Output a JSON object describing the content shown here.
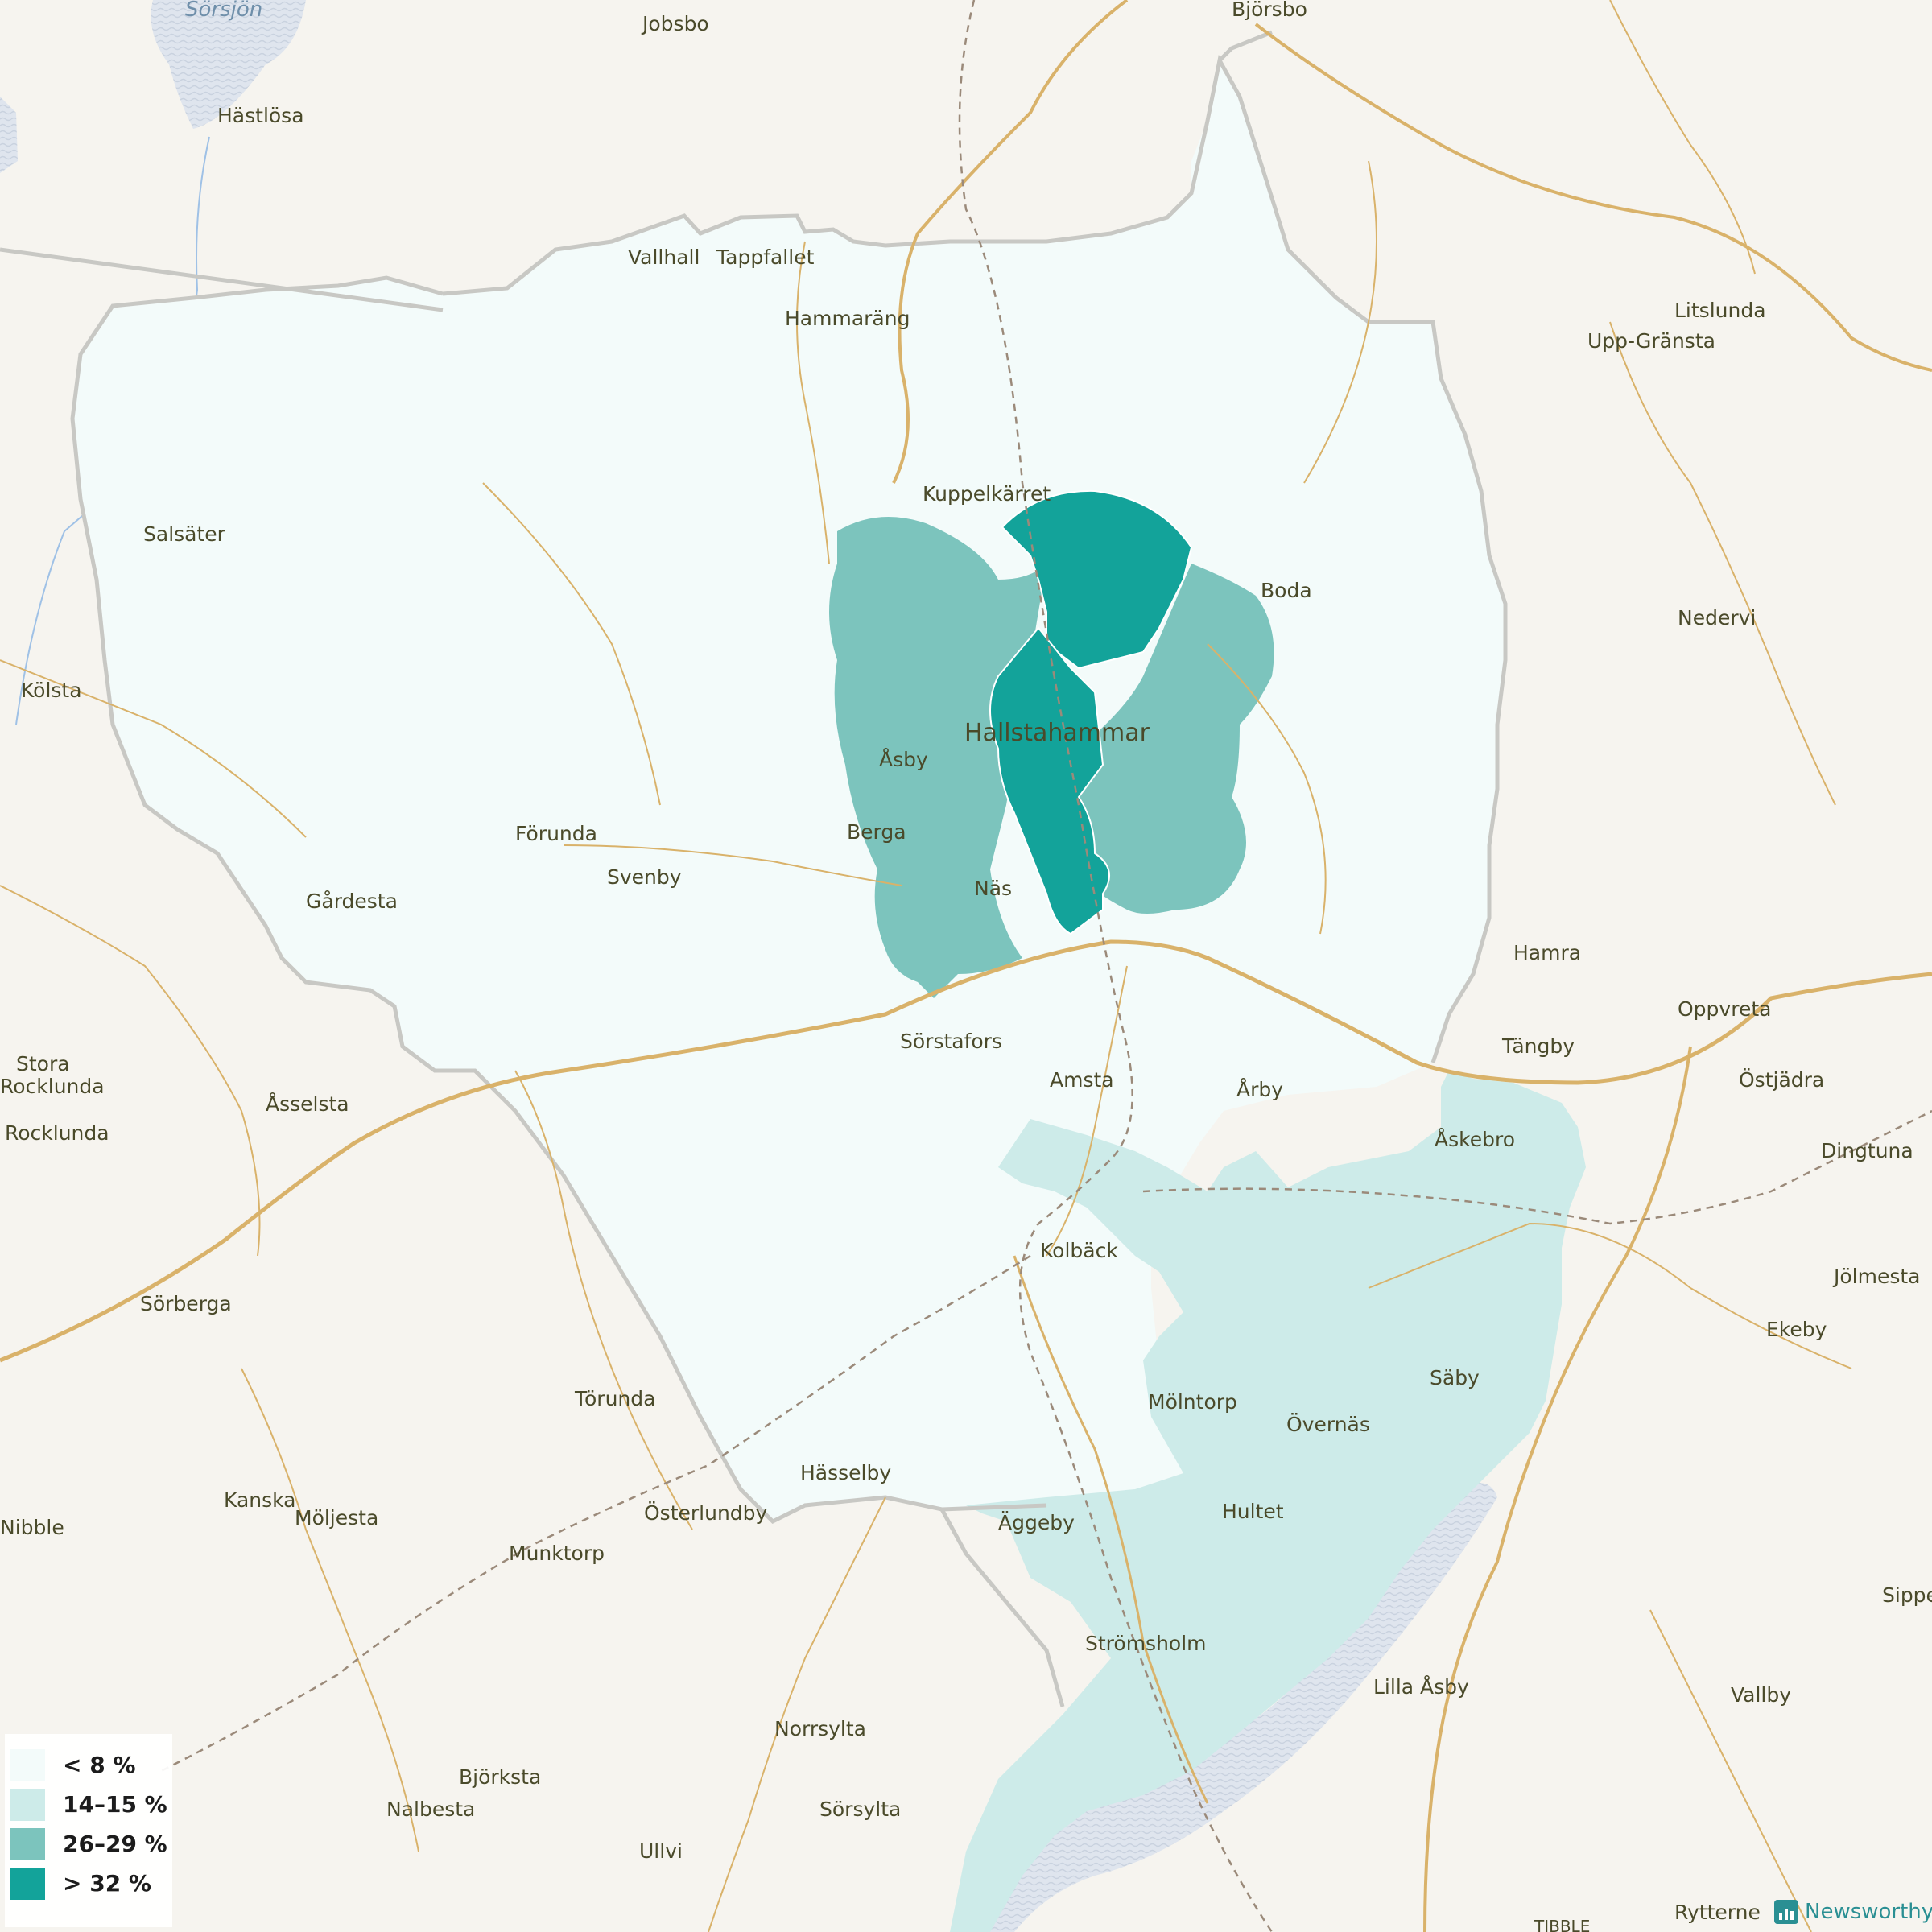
{
  "legend": {
    "items": [
      {
        "label": "< 8 %",
        "color": "#f3fbfa"
      },
      {
        "label": "14–15 %",
        "color": "#cdebe9"
      },
      {
        "label": "26–29 %",
        "color": "#7cc4bd"
      },
      {
        "label": "> 32 %",
        "color": "#13a39a"
      }
    ]
  },
  "brand": {
    "name": "Newsworthy",
    "icon": "bar-chart-icon"
  },
  "colors": {
    "background": "#f6f4ef",
    "road": "#d9b26a",
    "boundary": "#c8c8c4",
    "water": "#a9bfd4"
  },
  "places": {
    "sorsjon": "Sörsjön",
    "jobsbo": "Jobsbo",
    "bjorsbo": "Björsbo",
    "hastlosa": "Hästlösa",
    "vallhall": "Vallhall",
    "tappfallet": "Tappfallet",
    "hammarang": "Hammaräng",
    "litslunda": "Litslunda",
    "upp_gransta": "Upp-Gränsta",
    "salsater": "Salsäter",
    "kuppelkarret": "Kuppelkärret",
    "boda": "Boda",
    "nedervi": "Nedervi",
    "kolsta": "Kölsta",
    "hallstahammar": "Hallstahammar",
    "asby": "Åsby",
    "forunda": "Förunda",
    "berga": "Berga",
    "gardesta": "Gårdesta",
    "svenby": "Svenby",
    "nas": "Näs",
    "hamra": "Hamra",
    "oppvreta": "Oppvreta",
    "sorstafors": "Sörstafors",
    "tangby": "Tängby",
    "stora": "Stora",
    "rocklunda": "Rocklunda",
    "amsta": "Amsta",
    "arby": "Årby",
    "ostjadra": "Östjädra",
    "asselsta": "Åsselsta",
    "rocklunda2": "Rocklunda",
    "askebro": "Åskebro",
    "dingtuna": "Dingtuna",
    "kolback": "Kolbäck",
    "sorberga": "Sörberga",
    "jolmesta": "Jölmesta",
    "ekeby": "Ekeby",
    "saby": "Säby",
    "torunda": "Törunda",
    "molntorp": "Mölntorp",
    "overnas": "Övernäs",
    "hasselby": "Hässelby",
    "kanska": "Kanska",
    "hultet": "Hultet",
    "nibble": "Nibble",
    "moljesta": "Möljesta",
    "osterlundby": "Österlundby",
    "aggeby": "Äggeby",
    "munktorp": "Munktorp",
    "sippe": "Sippe",
    "stromsholm": "Strömsholm",
    "lilla_asby": "Lilla Åsby",
    "vallby": "Vallby",
    "norrsylta": "Norrsylta",
    "bjorksta": "Björksta",
    "nalbesta": "Nalbesta",
    "sorsylta": "Sörsylta",
    "ullvi": "Ullvi",
    "rytterne": "Rytterne",
    "tibble": "TIBBLE"
  }
}
